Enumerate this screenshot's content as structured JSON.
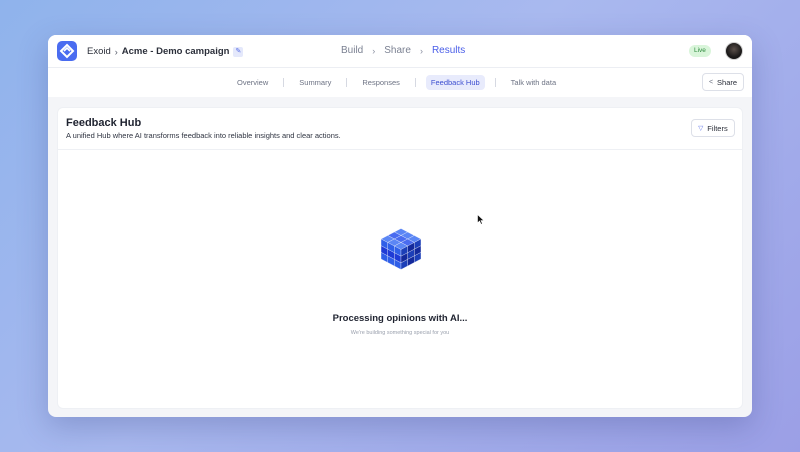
{
  "app": {
    "name": "Exoid",
    "campaign": "Acme - Demo campaign",
    "status": "Live"
  },
  "breadcrumb": {
    "separator": "›"
  },
  "steps": [
    {
      "label": "Build",
      "active": false
    },
    {
      "label": "Share",
      "active": false
    },
    {
      "label": "Results",
      "active": true
    }
  ],
  "tabs": [
    {
      "label": "Overview",
      "active": false
    },
    {
      "label": "Summary",
      "active": false
    },
    {
      "label": "Responses",
      "active": false
    },
    {
      "label": "Feedback Hub",
      "active": true
    },
    {
      "label": "Talk with data",
      "active": false
    }
  ],
  "toolbar": {
    "share_label": "Share",
    "filters_label": "Filters"
  },
  "card": {
    "title": "Feedback Hub",
    "subtitle": "A unified Hub where AI transforms feedback into reliable insights and clear actions."
  },
  "processing": {
    "title": "Processing opinions with AI...",
    "subtitle": "We're building something special for you"
  },
  "colors": {
    "accent": "#4a5ee8",
    "live_bg": "#d9f5da",
    "live_text": "#2e8a3e",
    "background_start": "#8fb3ec",
    "background_end": "#9b9fe6"
  },
  "icons": {
    "logo": "exoid-logo-icon",
    "share": "share-icon",
    "filters": "filter-icon",
    "edit": "edit-icon",
    "cursor": "mouse-pointer-icon",
    "loader": "cube-loader-icon"
  }
}
